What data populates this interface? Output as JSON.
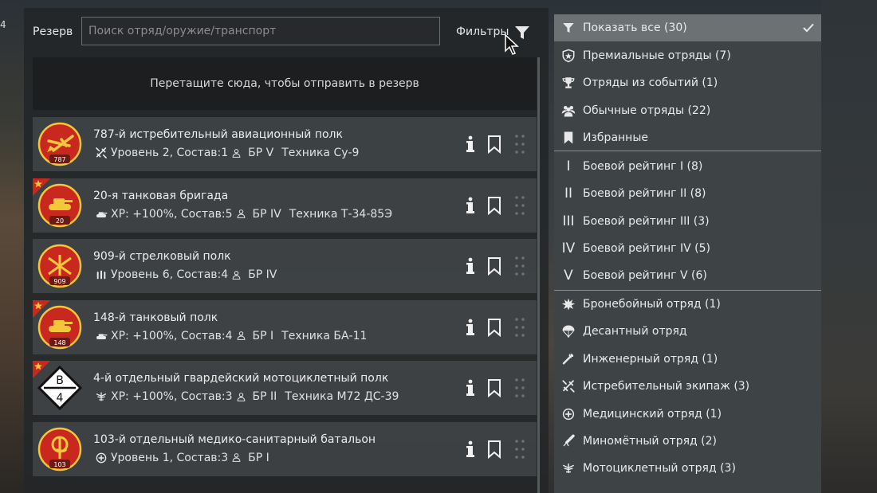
{
  "background": {
    "edge_number": "4"
  },
  "reserve": {
    "label": "Резерв",
    "search_placeholder": "Поиск отряд/оружие/транспорт",
    "filters_label": "Фильтры",
    "dropzone_text": "Перетащите сюда, чтобы отправить в резерв"
  },
  "squads": [
    {
      "title": "787-й истребительный авиационный полк",
      "type_icon": "fighter-icon",
      "info": "Уровень 2, Состав:1",
      "br": "БР V",
      "tech": "Техника Су-9",
      "emblem_number": "787",
      "premium": false
    },
    {
      "title": "20-я танковая бригада",
      "type_icon": "tank-icon",
      "info": "XP: +100%, Состав:5",
      "br": "БР IV",
      "tech": "Техника Т-34-85Э",
      "emblem_number": "20",
      "premium": true
    },
    {
      "title": "909-й стрелковый полк",
      "type_icon": "infantry-icon",
      "info": "Уровень 6, Состав:4",
      "br": "БР IV",
      "tech": "",
      "emblem_number": "909",
      "premium": false
    },
    {
      "title": "148-й танковый полк",
      "type_icon": "tank-icon",
      "info": "XP: +100%, Состав:4",
      "br": "БР I",
      "tech": "Техника БА-11",
      "emblem_number": "148",
      "premium": true
    },
    {
      "title": "4-й отдельный гвардейский мотоциклетный полк",
      "type_icon": "motorcycle-icon",
      "info": "XP: +100%, Состав:3",
      "br": "БР II",
      "tech": "Техника М72 ДС-39",
      "emblem_number": "",
      "emblem_letters": {
        "top": "В",
        "bottom": "4"
      },
      "premium": true
    },
    {
      "title": "103-й отдельный медико-санитарный батальон",
      "type_icon": "medic-icon",
      "info": "Уровень 1, Состав:3",
      "br": "БР I",
      "tech": "",
      "emblem_number": "103",
      "premium": false
    }
  ],
  "filters": [
    {
      "label": "Показать все (30)",
      "icon": "filter-icon",
      "active": true
    },
    {
      "label": "Премиальные отряды (7)",
      "icon": "premium-shield-icon"
    },
    {
      "label": "Отряды из событий (1)",
      "icon": "trophy-icon"
    },
    {
      "label": "Обычные отряды (22)",
      "icon": "people-icon"
    },
    {
      "label": "Избранные",
      "icon": "bookmark-icon"
    },
    {
      "label": "Боевой рейтинг I (8)",
      "icon": "br-1-icon",
      "roman": "I"
    },
    {
      "label": "Боевой рейтинг II (8)",
      "icon": "br-2-icon",
      "roman": "II"
    },
    {
      "label": "Боевой рейтинг III (3)",
      "icon": "br-3-icon",
      "roman": "III"
    },
    {
      "label": "Боевой рейтинг IV (5)",
      "icon": "br-4-icon",
      "roman": "IV"
    },
    {
      "label": "Боевой рейтинг V (6)",
      "icon": "br-5-icon",
      "roman": "V"
    },
    {
      "label": "Бронебойный отряд (1)",
      "icon": "explosion-icon"
    },
    {
      "label": "Десантный отряд",
      "icon": "parachute-icon"
    },
    {
      "label": "Инженерный отряд (1)",
      "icon": "wrench-icon"
    },
    {
      "label": "Истребительный экипаж (3)",
      "icon": "fighter-icon"
    },
    {
      "label": "Медицинский отряд (1)",
      "icon": "medic-icon"
    },
    {
      "label": "Миномётный отряд (2)",
      "icon": "mortar-icon"
    },
    {
      "label": "Мотоциклетный отряд (3)",
      "icon": "motorcycle-icon"
    }
  ]
}
